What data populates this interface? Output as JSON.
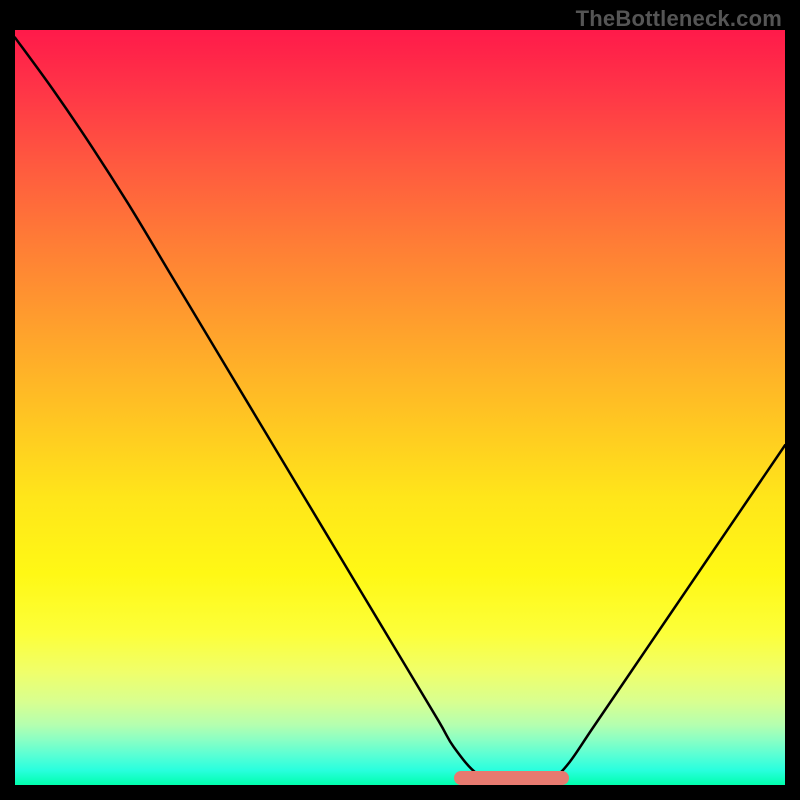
{
  "attribution": "TheBottleneck.com",
  "colors": {
    "page_bg": "#000000",
    "attribution_text": "#555555",
    "curve_stroke": "#000000",
    "highlight": "#e77a70",
    "gradient_top": "#ff1a4a",
    "gradient_bottom": "#00ffad"
  },
  "chart_data": {
    "type": "line",
    "title": "",
    "xlabel": "",
    "ylabel": "",
    "xlim": [
      0,
      100
    ],
    "ylim": [
      0,
      100
    ],
    "x": [
      0,
      5,
      10,
      15,
      20,
      25,
      30,
      35,
      40,
      45,
      50,
      55,
      57,
      60,
      63,
      65,
      68,
      70,
      72,
      75,
      80,
      85,
      90,
      95,
      100
    ],
    "values": [
      99,
      92,
      84.5,
      76.5,
      68,
      59.5,
      51,
      42.5,
      34,
      25.5,
      17,
      8.5,
      5,
      1.5,
      0.5,
      0.5,
      0.5,
      1,
      3,
      7.5,
      15,
      22.5,
      30,
      37.5,
      45
    ],
    "highlight_range_x": [
      57,
      72
    ],
    "notes": "Bottleneck-style curve: y represents bottleneck percentage (lower is better, green zone near bottom). Minimum (optimal) is around x≈63–68. Background is a vertical heat gradient from red (top, high bottleneck) to green (bottom, low bottleneck). No numeric axis ticks are visible."
  }
}
